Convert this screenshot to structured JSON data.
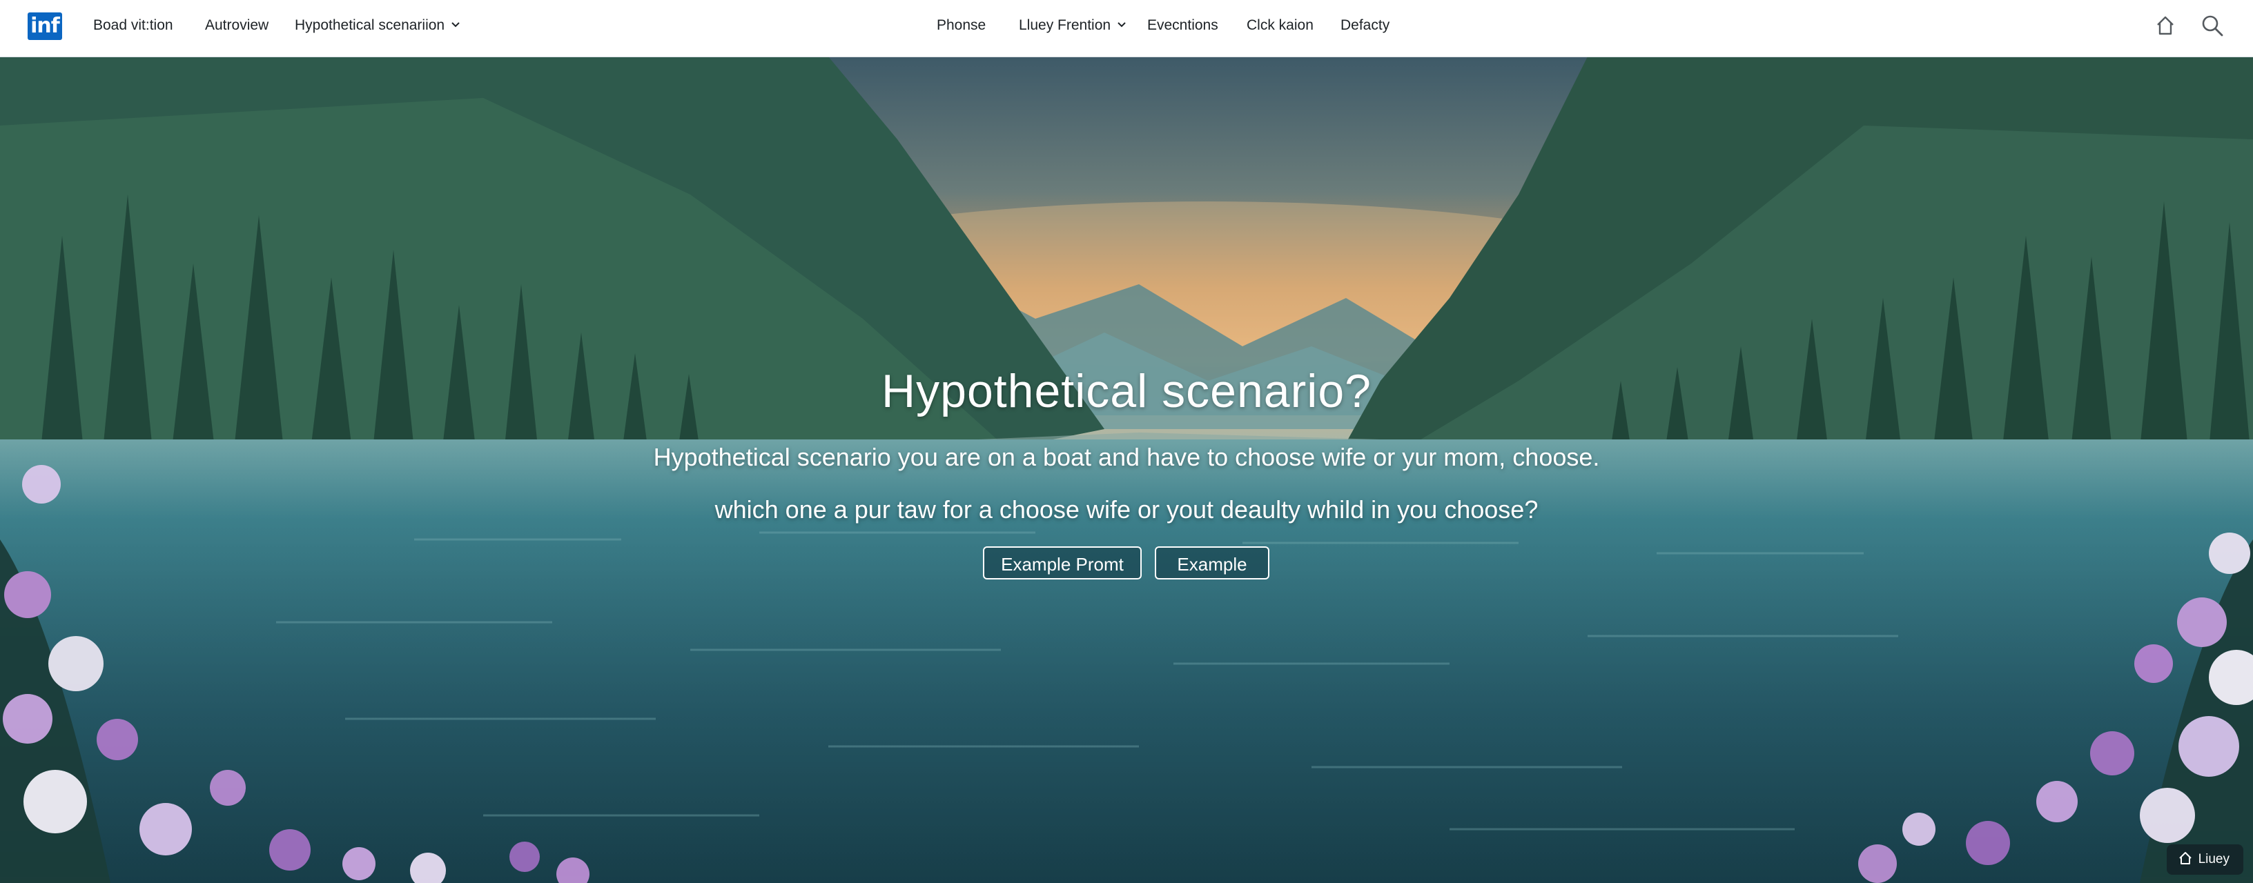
{
  "navbar": {
    "logo_text": "inf",
    "left_items": [
      {
        "label": "Boad vit:tion"
      },
      {
        "label": "Autroview"
      },
      {
        "label": "Hypothetical scenariion"
      }
    ],
    "center_items": [
      {
        "label": "Phonse"
      },
      {
        "label": "Lluey Frention"
      },
      {
        "label": "Evecntions"
      },
      {
        "label": "Clck kaion"
      },
      {
        "label": "Defacty"
      }
    ],
    "icons": [
      "home-icon",
      "search-icon"
    ]
  },
  "hero": {
    "title": "Hypothetical scenario?",
    "line1": "Hypothetical scenario you are on a boat and have to choose wife or yur mom, choose.",
    "line2": "which one a pur taw for a choose wife or yout deaulty whild in you choose?",
    "buttons": {
      "prompt_label": "Example Promt",
      "example_label": "Example"
    }
  },
  "badge": {
    "label": "Liuey",
    "icon": "home-icon"
  },
  "colors": {
    "brand": "#0b66c2",
    "nav_bg": "#ffffff",
    "nav_text": "#1d2226",
    "hero_text": "#ffffff",
    "water": "#2f6a78"
  }
}
